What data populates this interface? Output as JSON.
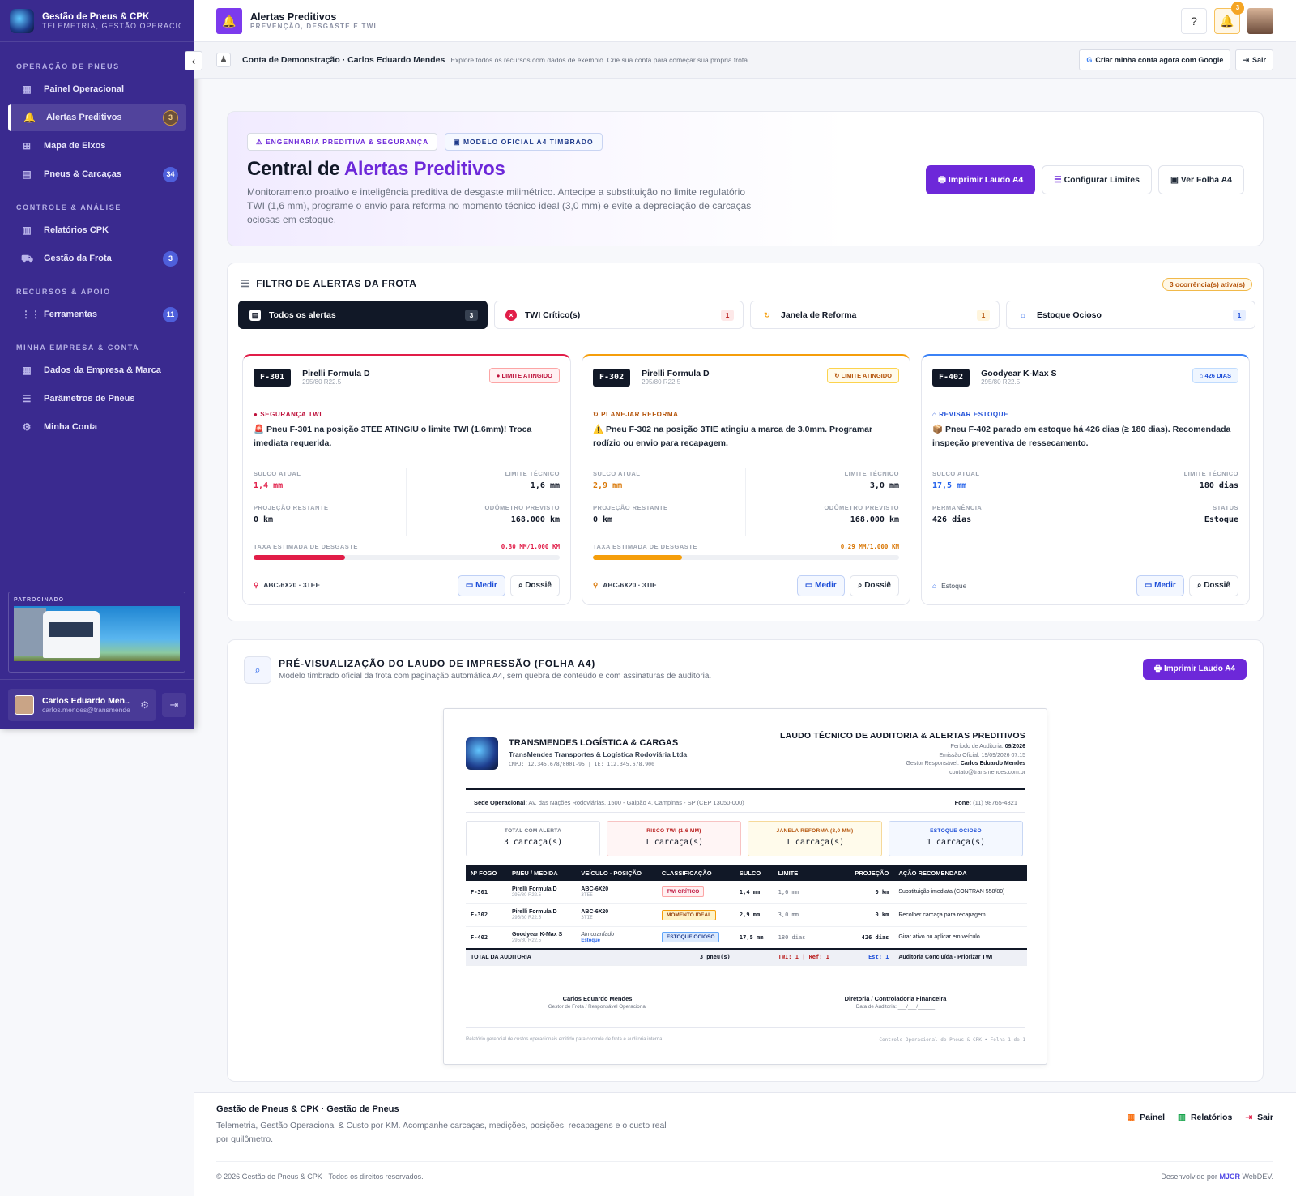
{
  "sidebar": {
    "brand_title": "Gestão de Pneus & CPK",
    "brand_sub": "TELEMETRIA, GESTÃO OPERACIO...",
    "sections": [
      {
        "title": "OPERAÇÃO DE PNEUS",
        "items": [
          {
            "label": "Painel Operacional",
            "icon": "dashboard-icon"
          },
          {
            "label": "Alertas Preditivos",
            "icon": "bell-icon",
            "badge": "3",
            "active": true
          },
          {
            "label": "Mapa de Eixos",
            "icon": "axle-map-icon"
          },
          {
            "label": "Pneus & Carcaças",
            "icon": "tire-icon",
            "badge": "34"
          }
        ]
      },
      {
        "title": "CONTROLE & ANÁLISE",
        "items": [
          {
            "label": "Relatórios CPK",
            "icon": "report-icon"
          },
          {
            "label": "Gestão da Frota",
            "icon": "truck-icon",
            "badge": "3"
          }
        ]
      },
      {
        "title": "RECURSOS & APOIO",
        "items": [
          {
            "label": "Ferramentas",
            "icon": "grid-icon",
            "badge": "11"
          }
        ]
      },
      {
        "title": "MINHA EMPRESA & CONTA",
        "items": [
          {
            "label": "Dados da Empresa & Marca",
            "icon": "building-icon"
          },
          {
            "label": "Parâmetros de Pneus",
            "icon": "sliders-icon"
          },
          {
            "label": "Minha Conta",
            "icon": "user-gear-icon"
          }
        ]
      }
    ],
    "sponsor_label": "PATROCINADO",
    "user_name": "Carlos Eduardo Men...",
    "user_email": "carlos.mendes@transmendes"
  },
  "header": {
    "title": "Alertas Preditivos",
    "subtitle": "PREVENÇÃO, DESGASTE E TWI",
    "notif_count": "3"
  },
  "demo": {
    "title": "Conta de Demonstração · Carlos Eduardo Mendes",
    "desc": "Explore todos os recursos com dados de exemplo. Crie sua conta para começar sua própria frota.",
    "google_btn": "Criar minha conta agora com Google",
    "logout_btn": "Sair"
  },
  "hero": {
    "pill1": "ENGENHARIA PREDITIVA & SEGURANÇA",
    "pill2": "MODELO OFICIAL A4 TIMBRADO",
    "title_a": "Central de ",
    "title_b": "Alertas Preditivos",
    "desc": "Monitoramento proativo e inteligência preditiva de desgaste milimétrico. Antecipe a substituição no limite regulatório TWI (1,6 mm), programe o envio para reforma no momento técnico ideal (3,0 mm) e evite a depreciação de carcaças ociosas em estoque.",
    "btn_print": "Imprimir Laudo A4",
    "btn_config": "Configurar Limites",
    "btn_sheet": "Ver Folha A4"
  },
  "filter": {
    "title": "FILTRO DE ALERTAS DA FROTA",
    "active_count": "3 ocorrência(s) ativa(s)",
    "tabs": [
      {
        "label": "Todos os alertas",
        "count": "3"
      },
      {
        "label": "TWI Crítico(s)",
        "count": "1"
      },
      {
        "label": "Janela de Reforma",
        "count": "1"
      },
      {
        "label": "Estoque Ocioso",
        "count": "1"
      }
    ]
  },
  "alerts": [
    {
      "id": "F-301",
      "name": "Pirelli Formula D",
      "size": "295/80 R22.5",
      "badge": "LIMITE ATINGIDO",
      "kind": "SEGURANÇA TWI",
      "msg": "🚨 Pneu F-301 na posição 3TEE ATINGIU o limite TWI (1.6mm)! Troca imediata requerida.",
      "l1": "SULCO ATUAL",
      "v1": "1,4 mm",
      "l2": "LIMITE TÉCNICO",
      "v2": "1,6 mm",
      "l3": "PROJEÇÃO RESTANTE",
      "v3": "0 km",
      "l4": "ODÔMETRO PREVISTO",
      "v4": "168.000 km",
      "rate_label": "TAXA ESTIMADA DE DESGASTE",
      "rate": "0,30 MM/1.000 KM",
      "rate_pct": 30,
      "loc": "ABC-6X20 · 3TEE",
      "measure": "Medir",
      "dossier": "Dossiê"
    },
    {
      "id": "F-302",
      "name": "Pirelli Formula D",
      "size": "295/80 R22.5",
      "badge": "LIMITE ATINGIDO",
      "kind": "PLANEJAR REFORMA",
      "msg": "⚠️ Pneu F-302 na posição 3TIE atingiu a marca de 3.0mm. Programar rodízio ou envio para recapagem.",
      "l1": "SULCO ATUAL",
      "v1": "2,9 mm",
      "l2": "LIMITE TÉCNICO",
      "v2": "3,0 mm",
      "l3": "PROJEÇÃO RESTANTE",
      "v3": "0 km",
      "l4": "ODÔMETRO PREVISTO",
      "v4": "168.000 km",
      "rate_label": "TAXA ESTIMADA DE DESGASTE",
      "rate": "0,29 MM/1.000 KM",
      "rate_pct": 29,
      "loc": "ABC-6X20 · 3TIE",
      "measure": "Medir",
      "dossier": "Dossiê"
    },
    {
      "id": "F-402",
      "name": "Goodyear K-Max S",
      "size": "295/80 R22.5",
      "badge": "426 DIAS",
      "kind": "REVISAR ESTOQUE",
      "msg": "📦 Pneu F-402 parado em estoque há 426 dias (≥ 180 dias). Recomendada inspeção preventiva de ressecamento.",
      "l1": "SULCO ATUAL",
      "v1": "17,5 mm",
      "l2": "LIMITE TÉCNICO",
      "v2": "180 dias",
      "l3": "PERMANÊNCIA",
      "v3": "426 dias",
      "l4": "STATUS",
      "v4": "Estoque",
      "loc": "Estoque",
      "measure": "Medir",
      "dossier": "Dossiê"
    }
  ],
  "preview": {
    "title": "PRÉ-VISUALIZAÇÃO DO LAUDO DE IMPRESSÃO (FOLHA A4)",
    "desc": "Modelo timbrado oficial da frota com paginação automática A4, sem quebra de conteúdo e com assinaturas de auditoria.",
    "btn": "Imprimir Laudo A4",
    "sheet": {
      "company": "TRANSMENDES LOGÍSTICA & CARGAS",
      "company2": "TransMendes Transportes & Logística Rodoviária Ltda",
      "company3": "CNPJ: 12.345.678/0001-95 | IE: 112.345.678.900",
      "report_title": "LAUDO TÉCNICO DE AUDITORIA & ALERTAS PREDITIVOS",
      "period_label": "Período de Auditoria:",
      "period": "09/2026",
      "emission": "Emissão Oficial: 19/09/2026 07:15",
      "manager_label": "Gestor Responsável:",
      "manager": "Carlos Eduardo Mendes",
      "contact": "contato@transmendes.com.br",
      "addr_label": "Sede Operacional:",
      "addr": "Av. das Nações Rodoviárias, 1500 - Galpão 4, Campinas - SP (CEP 13050-000)",
      "phone_label": "Fone:",
      "phone": "(11) 98765-4321",
      "stats": [
        {
          "label": "TOTAL COM ALERTA",
          "value": "3 carcaça(s)"
        },
        {
          "label": "RISCO TWI (1,6 MM)",
          "value": "1 carcaça(s)"
        },
        {
          "label": "JANELA REFORMA (3,0 MM)",
          "value": "1 carcaça(s)"
        },
        {
          "label": "ESTOQUE OCIOSO",
          "value": "1 carcaça(s)"
        }
      ],
      "columns": [
        "Nº FOGO",
        "PNEU / MEDIDA",
        "VEÍCULO - POSIÇÃO",
        "CLASSIFICAÇÃO",
        "SULCO",
        "LIMITE",
        "PROJEÇÃO",
        "AÇÃO RECOMENDADA"
      ],
      "rows": [
        {
          "fogo": "F-301",
          "pneu": "Pirelli Formula D",
          "medida": "295/80 R22.5",
          "veic": "ABC-6X20",
          "pos": "3TEE",
          "cls": "TWI CRÍTICO",
          "sulco": "1,4 mm",
          "lim": "1,6 mm",
          "proj": "0 km",
          "acao": "Substituição imediata (CONTRAN 558/80)"
        },
        {
          "fogo": "F-302",
          "pneu": "Pirelli Formula D",
          "medida": "295/80 R22.5",
          "veic": "ABC-6X20",
          "pos": "3TIE",
          "cls": "MOMENTO IDEAL",
          "sulco": "2,9 mm",
          "lim": "3,0 mm",
          "proj": "0 km",
          "acao": "Recolher carcaça para recapagem"
        },
        {
          "fogo": "F-402",
          "pneu": "Goodyear K-Max S",
          "medida": "295/80 R22.5",
          "veic": "Almoxarifado",
          "pos": "Estoque",
          "cls": "ESTOQUE OCIOSO",
          "sulco": "17,5 mm",
          "lim": "180 dias",
          "proj": "426 dias",
          "acao": "Girar ativo ou aplicar em veículo"
        }
      ],
      "total_label": "TOTAL DA AUDITORIA",
      "total_count": "3 pneu(s)",
      "total_twi": "TWI: 1 | Ref: 1",
      "total_est": "Est: 1",
      "total_action": "Auditoria Concluída - Priorizar TWI",
      "sig1_name": "Carlos Eduardo Mendes",
      "sig1_role": "Gestor de Frota / Responsável Operacional",
      "sig2_name": "Diretoria / Controladoria Financeira",
      "sig2_role": "Data de Auditoria: ___/___/______",
      "foot_left": "Relatório gerencial de custos operacionais emitido para controle de frota e auditoria interna.",
      "foot_right": "Controle Operacional de Pneus & CPK • Folha 1 de 1"
    }
  },
  "footer": {
    "title": "Gestão de Pneus & CPK · Gestão de Pneus",
    "desc": "Telemetria, Gestão Operacional & Custo por KM. Acompanhe carcaças, medições, posições, recapagens e o custo real por quilômetro.",
    "links": [
      "Painel",
      "Relatórios",
      "Sair"
    ],
    "copyright": "© 2026 Gestão de Pneus & CPK · Todos os direitos reservados.",
    "dev_label": "Desenvolvido por",
    "dev_brand": "MJCR",
    "dev_suffix": "WebDEV."
  },
  "colors": {
    "accent": "#6d28d9",
    "sidebar": "#3a2a8f",
    "danger": "#e11d48",
    "warning": "#f59e0b",
    "info": "#3b82f6"
  }
}
